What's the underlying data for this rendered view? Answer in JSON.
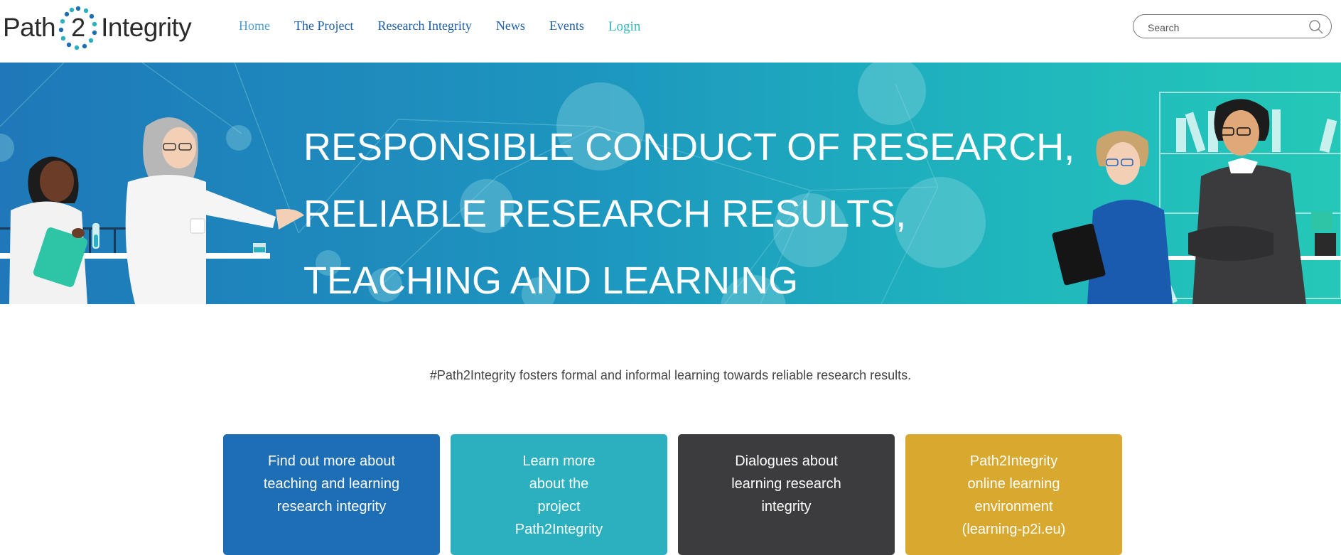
{
  "header": {
    "logo": {
      "word_left": "Path",
      "number": "2",
      "word_right": "Integrity"
    },
    "nav": [
      {
        "label": "Home",
        "state": "active"
      },
      {
        "label": "The Project"
      },
      {
        "label": "Research Integrity"
      },
      {
        "label": "News"
      },
      {
        "label": "Events"
      },
      {
        "label": "Login"
      }
    ],
    "search": {
      "placeholder": "Search",
      "icon": "search-icon"
    }
  },
  "hero": {
    "title": "RESPONSIBLE CONDUCT OF RESEARCH, RELIABLE RESEARCH RESULTS, TEACHING AND LEARNING"
  },
  "intro": {
    "text": "#Path2Integrity fosters formal and informal learning towards reliable research results."
  },
  "cards": [
    {
      "label": "Find out more about teaching and learning research integrity",
      "color": "#1e6eb5"
    },
    {
      "label": "Learn more about the project Path2Integrity",
      "color": "#2bb0bf"
    },
    {
      "label": "Dialogues about learning research integrity",
      "color": "#3c3c3e"
    },
    {
      "label": "Path2Integrity online learning environment (learning-p2i.eu)",
      "color": "#d9a82e"
    }
  ],
  "colors": {
    "nav_link": "#1b5fa8",
    "nav_active": "#4a9ed6",
    "login": "#34b8bd",
    "hero_start": "#1f78b9",
    "hero_end": "#25c8b8"
  }
}
